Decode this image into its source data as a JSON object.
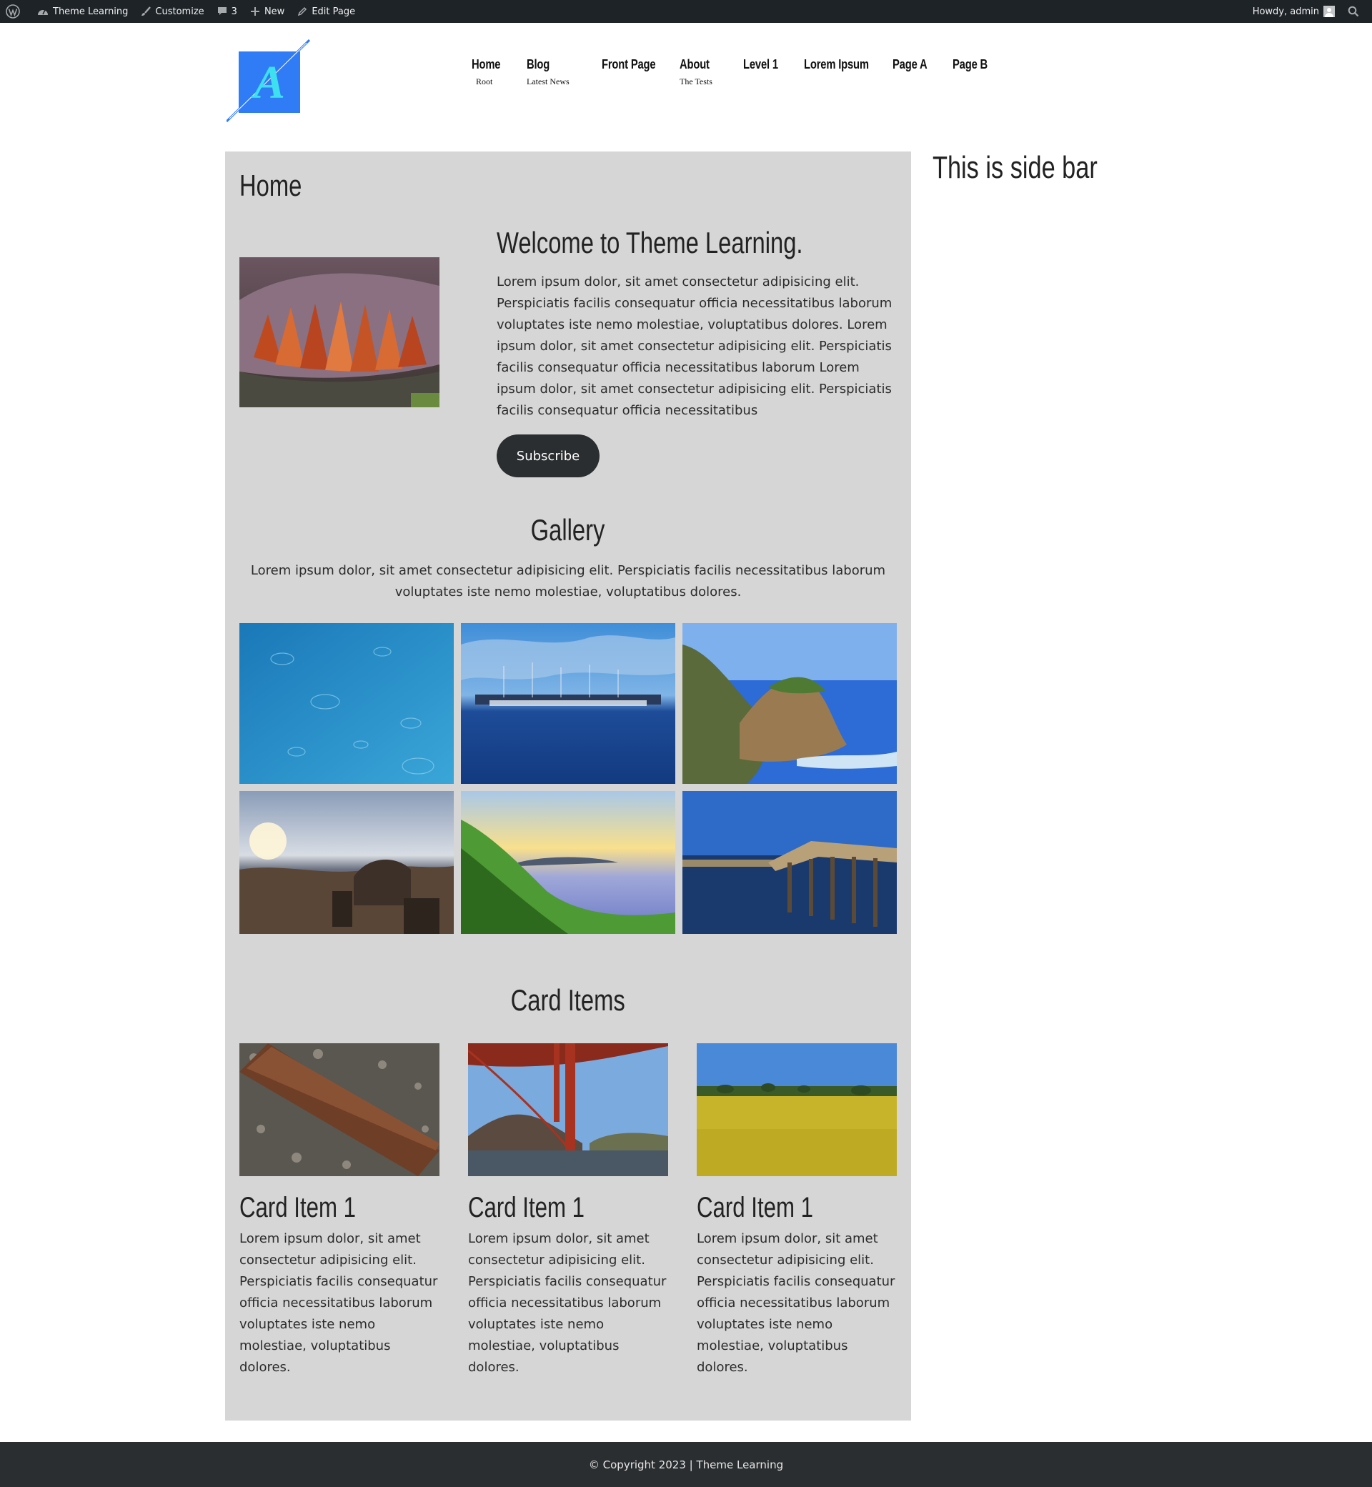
{
  "adminbar": {
    "site_name": "Theme Learning",
    "customize": "Customize",
    "comments_count": "3",
    "new": "New",
    "edit_page": "Edit Page",
    "howdy": "Howdy, admin"
  },
  "header": {
    "logo_letter": "A",
    "nav": [
      {
        "label": "Home",
        "sub": "Root"
      },
      {
        "label": "Blog",
        "sub": "Latest News"
      },
      {
        "label": "Front Page",
        "sub": ""
      },
      {
        "label": "About",
        "sub": "The Tests"
      },
      {
        "label": "Level 1",
        "sub": ""
      },
      {
        "label": "Lorem Ipsum",
        "sub": ""
      },
      {
        "label": "Page A",
        "sub": ""
      },
      {
        "label": "Page B",
        "sub": ""
      }
    ]
  },
  "main": {
    "page_title": "Home",
    "hero": {
      "heading": "Welcome to Theme Learning.",
      "text": "Lorem ipsum dolor, sit amet consectetur adipisicing elit. Perspiciatis facilis consequatur officia necessitatibus laborum voluptates iste nemo molestiae, voluptatibus dolores. Lorem ipsum dolor, sit amet consectetur adipisicing elit. Perspiciatis facilis consequatur officia necessitatibus laborum Lorem ipsum dolor, sit amet consectetur adipisicing elit. Perspiciatis facilis consequatur officia necessitatibus",
      "button": "Subscribe"
    },
    "gallery": {
      "title": "Gallery",
      "text": "Lorem ipsum dolor, sit amet consectetur adipisicing elit. Perspiciatis facilis necessitatibus laborum voluptates iste nemo molestiae, voluptatibus dolores."
    },
    "cards": {
      "title": "Card Items",
      "items": [
        {
          "title": "Card Item 1",
          "text": "Lorem ipsum dolor, sit amet consectetur adipisicing elit. Perspiciatis facilis consequatur officia necessitatibus laborum voluptates iste nemo molestiae, voluptatibus dolores."
        },
        {
          "title": "Card Item 1",
          "text": "Lorem ipsum dolor, sit amet consectetur adipisicing elit. Perspiciatis facilis consequatur officia necessitatibus laborum voluptates iste nemo molestiae, voluptatibus dolores."
        },
        {
          "title": "Card Item 1",
          "text": "Lorem ipsum dolor, sit amet consectetur adipisicing elit. Perspiciatis facilis consequatur officia necessitatibus laborum voluptates iste nemo molestiae, voluptatibus dolores."
        }
      ]
    }
  },
  "sidebar": {
    "title": "This is side bar"
  },
  "footer": {
    "text": "© Copyright 2023 | Theme Learning"
  },
  "colors": {
    "adminbar_bg": "#1d2327",
    "content_bg": "#d6d6d6",
    "button_bg": "#2b2e30",
    "footer_bg": "#2b2e30",
    "logo_blue": "#2f7cf6",
    "logo_cyan": "#3ee0f0"
  }
}
